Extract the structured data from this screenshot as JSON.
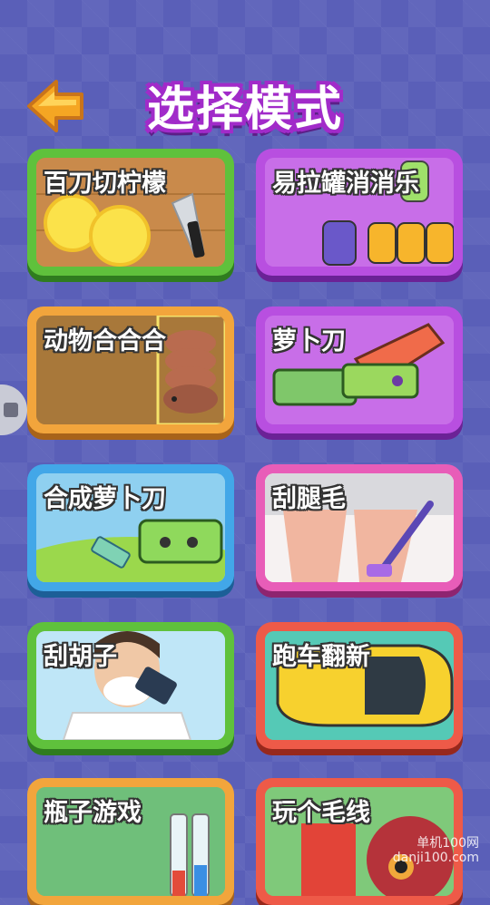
{
  "header": {
    "title": "选择模式"
  },
  "modes": [
    {
      "label": "百刀切柠檬"
    },
    {
      "label": "易拉罐消消乐"
    },
    {
      "label": "动物合合合"
    },
    {
      "label": "萝卜刀"
    },
    {
      "label": "合成萝卜刀"
    },
    {
      "label": "刮腿毛"
    },
    {
      "label": "刮胡子"
    },
    {
      "label": "跑车翻新"
    },
    {
      "label": "瓶子游戏"
    },
    {
      "label": "玩个毛线"
    }
  ],
  "watermark": {
    "line1": "单机100网",
    "line2": "danji100.com"
  },
  "colors": {
    "background": "#5a5fb8",
    "title_outline": "#a12bc9",
    "back_arrow": "#f5a623"
  }
}
